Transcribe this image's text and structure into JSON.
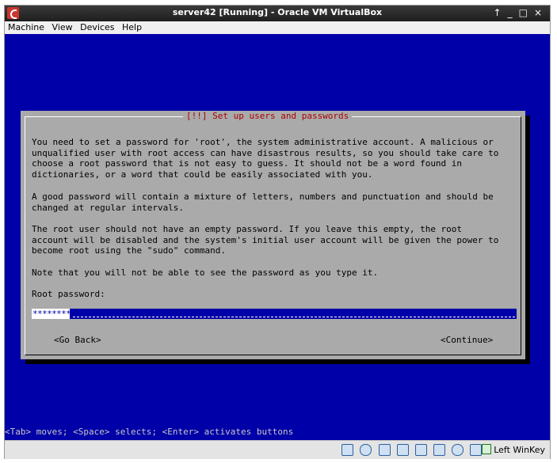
{
  "window": {
    "title": "server42 [Running] - Oracle VM VirtualBox",
    "buttons": [
      "↑",
      "_",
      "□",
      "×"
    ]
  },
  "menu": [
    "Machine",
    "View",
    "Devices",
    "Help"
  ],
  "dialog": {
    "title": "[!!] Set up users and passwords",
    "paragraph1": "You need to set a password for 'root', the system administrative account. A malicious or\nunqualified user with root access can have disastrous results, so you should take care to\nchoose a root password that is not easy to guess. It should not be a word found in\ndictionaries, or a word that could be easily associated with you.",
    "paragraph2": "A good password will contain a mixture of letters, numbers and punctuation and should be\nchanged at regular intervals.",
    "paragraph3": "The root user should not have an empty password. If you leave this empty, the root\naccount will be disabled and the system's initial user account will be given the power to\nbecome root using the \"sudo\" command.",
    "paragraph4": "Note that you will not be able to see the password as you type it.",
    "field_label": "Root password:",
    "field_value": "********",
    "go_back": "<Go Back>",
    "continue": "<Continue>"
  },
  "hint": "<Tab> moves; <Space> selects; <Enter> activates buttons",
  "statusbar": {
    "host_key": "Left WinKey"
  },
  "colors": {
    "console_bg": "#0000a8",
    "dialog_bg": "#aaaaaa",
    "dialog_title": "#aa0000"
  }
}
